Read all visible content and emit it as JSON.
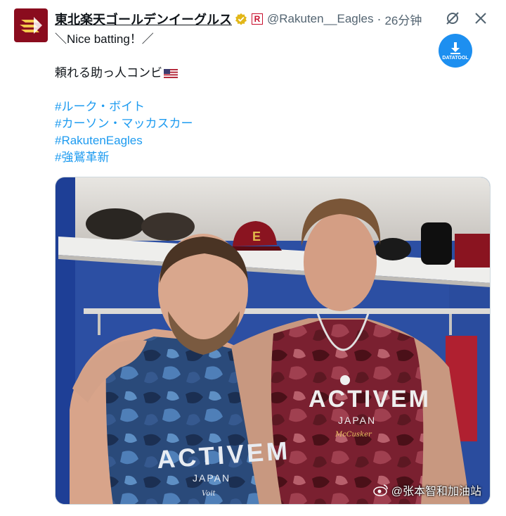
{
  "tweet": {
    "author_name": "東北楽天ゴールデンイーグルス",
    "badge_letter": "R",
    "handle": "@Rakuten__Eagles",
    "separator": "·",
    "time": "26分钟",
    "lines": [
      "＼Nice batting！／",
      "",
      "頼れる助っ人コンビ"
    ],
    "hashtags": [
      "#ルーク・ボイト",
      "#カーソン・マッカスカー",
      "#RakutenEagles",
      "#強鷲革新"
    ]
  },
  "datatool": {
    "label": "DATATOOL"
  },
  "photo": {
    "shirt_left": {
      "brand": "ACTIVEM",
      "sub": "JAPAN",
      "signature": "Voit"
    },
    "shirt_right": {
      "brand": "ACTIVEM",
      "sub": "JAPAN",
      "signature": "McCusker"
    },
    "cap_logo": "E"
  },
  "watermark": {
    "text": "@张本智和加油站"
  },
  "icons": [
    "verified-icon",
    "grok-icon",
    "close-icon",
    "download-icon",
    "us-flag-icon",
    "weibo-icon"
  ],
  "colors": {
    "accent": "#1d9bf0",
    "eagles": "#8a0c1e",
    "text": "#0f1419",
    "muted": "#536471"
  }
}
